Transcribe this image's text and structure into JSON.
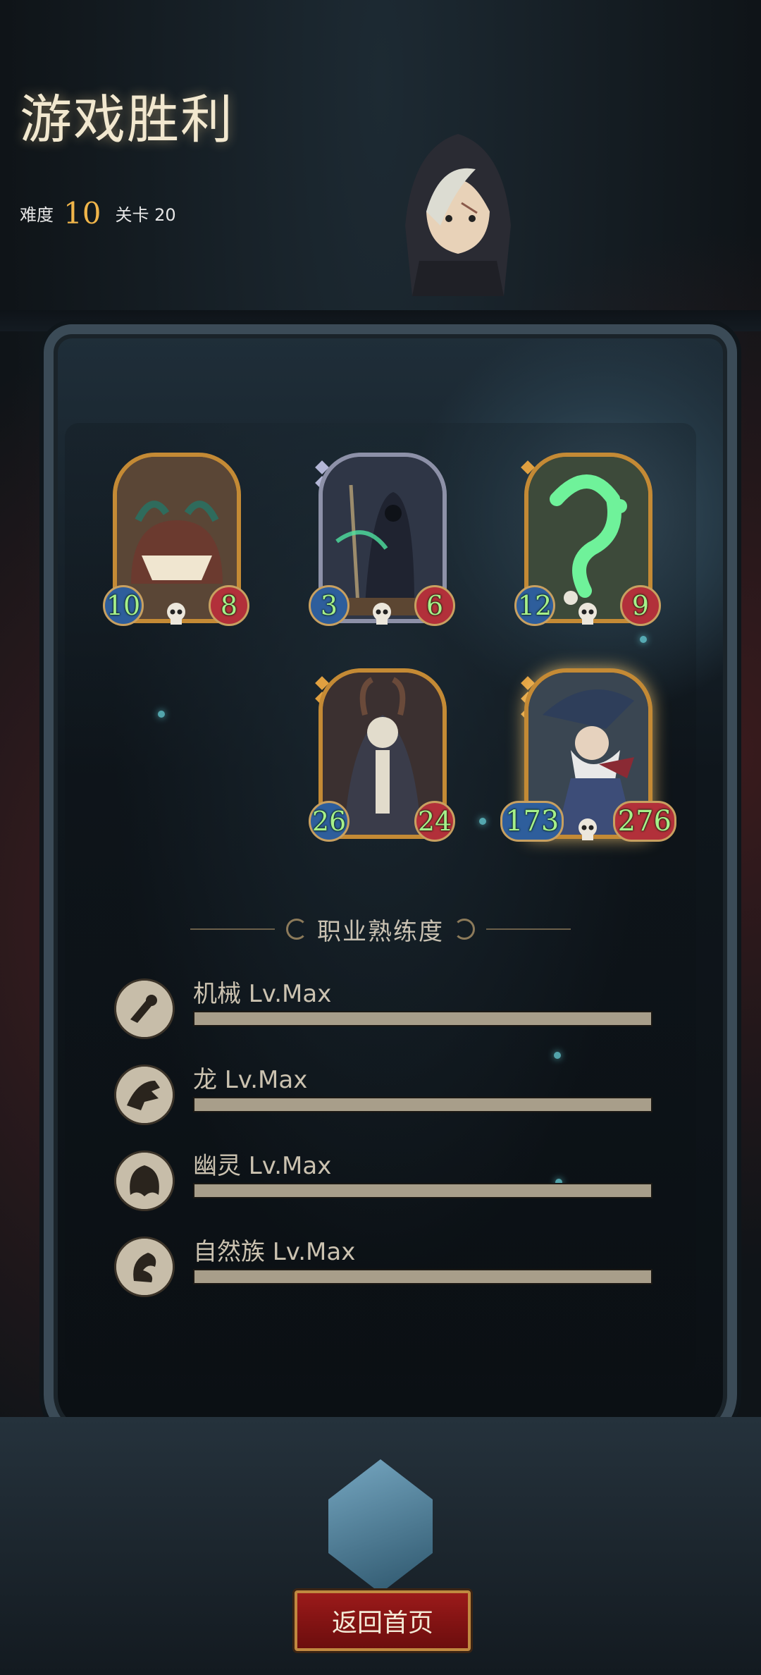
{
  "header": {
    "title": "游戏胜利",
    "difficulty_label": "难度",
    "difficulty_value": "10",
    "level_label": "关卡 20"
  },
  "cards": [
    {
      "name": "monster-card-1",
      "atk": "10",
      "hp": "8",
      "frame": "gold"
    },
    {
      "name": "monster-card-2",
      "atk": "3",
      "hp": "6",
      "frame": "silver"
    },
    {
      "name": "monster-card-3",
      "atk": "12",
      "hp": "9",
      "frame": "gold"
    },
    {
      "name": "monster-card-4",
      "atk": "26",
      "hp": "24",
      "frame": "gold"
    },
    {
      "name": "monster-card-5",
      "atk": "173",
      "hp": "276",
      "frame": "gold"
    }
  ],
  "mastery": {
    "title": "职业熟练度",
    "items": [
      {
        "label": "机械 Lv.Max",
        "icon": "mech-icon",
        "progress": 1.0
      },
      {
        "label": "龙 Lv.Max",
        "icon": "dragon-icon",
        "progress": 1.0
      },
      {
        "label": "幽灵 Lv.Max",
        "icon": "ghost-icon",
        "progress": 1.0
      },
      {
        "label": "自然族 Lv.Max",
        "icon": "nature-icon",
        "progress": 1.0
      }
    ]
  },
  "return_button": "返回首页",
  "colors": {
    "gold": "#c48a35",
    "silver": "#8d91a8",
    "stat_text": "#a6f08a",
    "button": "#8b1616"
  }
}
